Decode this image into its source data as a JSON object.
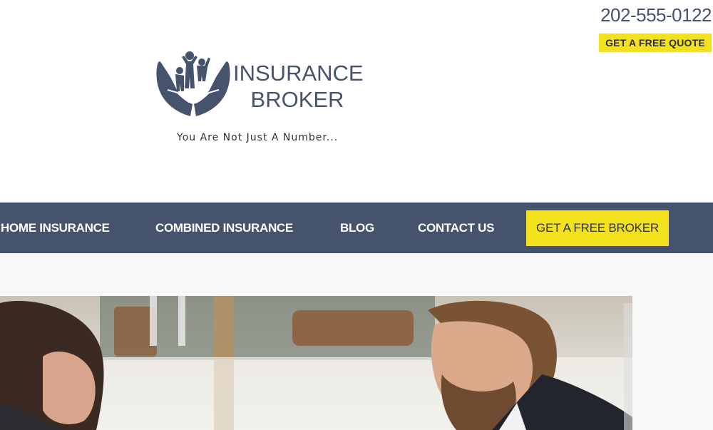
{
  "header": {
    "phone": "202-555-0122",
    "quote_button": "GET A FREE QUOTE",
    "logo_line1": "INSURANCE",
    "logo_line2": "BROKER",
    "tagline": "You Are Not Just A Number..."
  },
  "nav": {
    "items": [
      {
        "label": "HOME INSURANCE"
      },
      {
        "label": "COMBINED INSURANCE"
      },
      {
        "label": "BLOG"
      },
      {
        "label": "CONTACT US"
      }
    ],
    "cta": "GET A FREE BROKER"
  },
  "colors": {
    "brand": "#45536c",
    "accent": "#f3e21b"
  },
  "hero": {
    "image": "photo of a woman and a bearded man in conversation"
  }
}
